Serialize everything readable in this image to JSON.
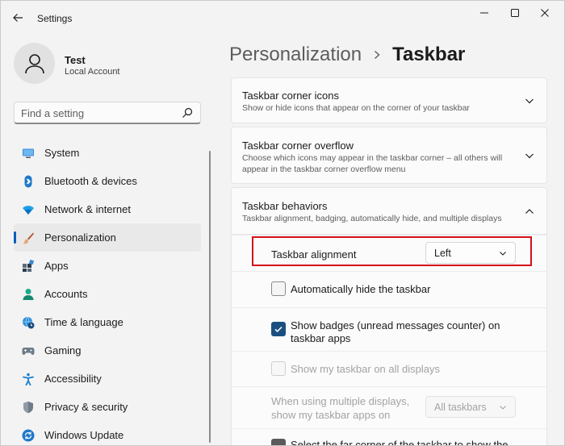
{
  "window": {
    "title": "Settings"
  },
  "profile": {
    "name": "Test",
    "account_type": "Local Account"
  },
  "search": {
    "placeholder": "Find a setting"
  },
  "nav": {
    "items": [
      {
        "label": "System",
        "icon": "monitor-icon"
      },
      {
        "label": "Bluetooth & devices",
        "icon": "bluetooth-icon"
      },
      {
        "label": "Network & internet",
        "icon": "wifi-icon"
      },
      {
        "label": "Personalization",
        "icon": "brush-icon",
        "active": true
      },
      {
        "label": "Apps",
        "icon": "apps-icon"
      },
      {
        "label": "Accounts",
        "icon": "person-icon"
      },
      {
        "label": "Time & language",
        "icon": "globe-clock-icon"
      },
      {
        "label": "Gaming",
        "icon": "gamepad-icon"
      },
      {
        "label": "Accessibility",
        "icon": "accessibility-icon"
      },
      {
        "label": "Privacy & security",
        "icon": "shield-icon"
      },
      {
        "label": "Windows Update",
        "icon": "update-icon"
      }
    ]
  },
  "breadcrumb": {
    "parent": "Personalization",
    "separator": "›",
    "current": "Taskbar"
  },
  "cards": {
    "corner_icons": {
      "title": "Taskbar corner icons",
      "description": "Show or hide icons that appear on the corner of your taskbar"
    },
    "corner_overflow": {
      "title": "Taskbar corner overflow",
      "description_line1": "Choose which icons may appear in the taskbar corner – all others will",
      "description_line2": "appear in the taskbar corner overflow menu"
    },
    "behaviors": {
      "title": "Taskbar behaviors",
      "description": "Taskbar alignment, badging, automatically hide, and multiple displays"
    }
  },
  "behaviors": {
    "alignment": {
      "label": "Taskbar alignment",
      "value": "Left"
    },
    "auto_hide": {
      "label": "Automatically hide the taskbar",
      "checked": false
    },
    "badges": {
      "label_line1": "Show badges (unread messages counter) on",
      "label_line2": "taskbar apps",
      "checked": true
    },
    "all_displays": {
      "label": "Show my taskbar on all displays",
      "checked": false,
      "disabled": true
    },
    "multiple_displays": {
      "label_line1": "When using multiple displays,",
      "label_line2": "show my taskbar apps on",
      "value": "All taskbars",
      "disabled": true
    },
    "far_corner": {
      "label": "Select the far corner of the taskbar to show the"
    }
  },
  "colors": {
    "accent": "#005fb8",
    "highlight": "#d4111b",
    "checkbox_checked": "#1b4f80"
  }
}
